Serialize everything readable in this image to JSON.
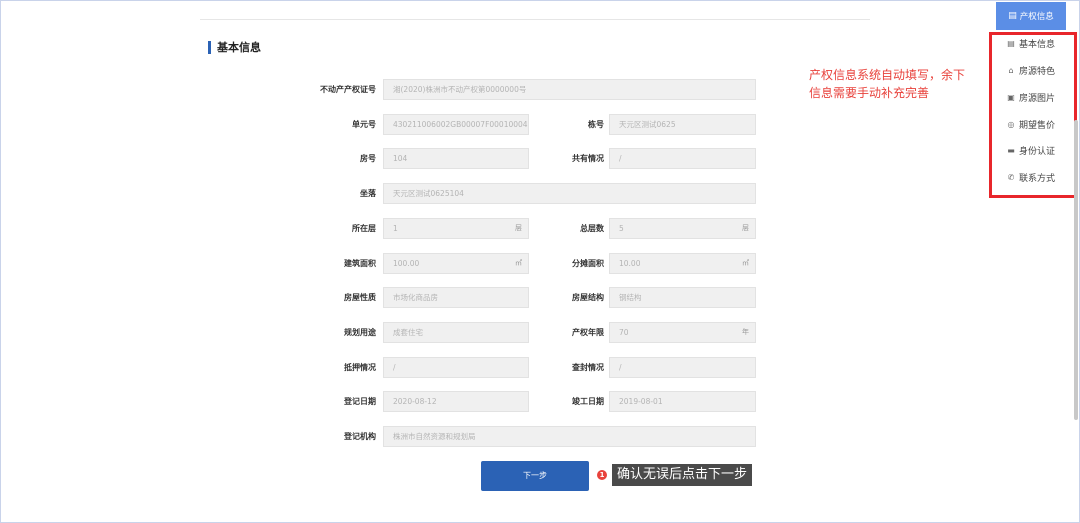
{
  "section": {
    "title": "基本信息"
  },
  "form": {
    "cert_no": {
      "label": "不动产产权证号",
      "value": "湘(2020)株洲市不动产权第0000000号"
    },
    "unit_no": {
      "label": "单元号",
      "value": "430211006002GB00007F00010004"
    },
    "building_no": {
      "label": "栋号",
      "value": "天元区测试0625"
    },
    "room_no": {
      "label": "房号",
      "value": "104"
    },
    "co_own": {
      "label": "共有情况",
      "value": "/"
    },
    "location": {
      "label": "坐落",
      "value": "天元区测试0625104"
    },
    "floor": {
      "label": "所在层",
      "value": "1",
      "unit": "层"
    },
    "total_floors": {
      "label": "总层数",
      "value": "5",
      "unit": "层"
    },
    "build_area": {
      "label": "建筑面积",
      "value": "100.00",
      "unit": "㎡"
    },
    "shared_area": {
      "label": "分摊面积",
      "value": "10.00",
      "unit": "㎡"
    },
    "property_nature": {
      "label": "房屋性质",
      "value": "市场化商品房"
    },
    "structure": {
      "label": "房屋结构",
      "value": "钢结构"
    },
    "usage": {
      "label": "规划用途",
      "value": "成套住宅"
    },
    "term": {
      "label": "产权年限",
      "value": "70",
      "unit": "年"
    },
    "mortgage": {
      "label": "抵押情况",
      "value": "/"
    },
    "seizure": {
      "label": "查封情况",
      "value": "/"
    },
    "reg_date": {
      "label": "登记日期",
      "value": "2020-08-12"
    },
    "completion_date": {
      "label": "竣工日期",
      "value": "2019-08-01"
    },
    "reg_org": {
      "label": "登记机构",
      "value": "株洲市自然资源和规划局"
    }
  },
  "next_button": {
    "label": "下一步"
  },
  "hint": {
    "badge": "1",
    "text": "确认无误后点击下一步"
  },
  "annotation": {
    "line1": "产权信息系统自动填写，余下",
    "line2": "信息需要手动补充完善"
  },
  "side_nav": {
    "active_tab": {
      "icon": "document-icon",
      "label": "产权信息"
    },
    "items": [
      {
        "icon": "document-icon",
        "label": "基本信息"
      },
      {
        "icon": "home-icon",
        "label": "房源特色"
      },
      {
        "icon": "image-icon",
        "label": "房源图片"
      },
      {
        "icon": "price-icon",
        "label": "期望售价"
      },
      {
        "icon": "id-card-icon",
        "label": "身份认证"
      },
      {
        "icon": "phone-icon",
        "label": "联系方式"
      }
    ]
  },
  "colors": {
    "accent": "#2b62b5",
    "tab": "#5b8ee6",
    "highlight": "#e8262b",
    "annotation": "#e8423c"
  }
}
